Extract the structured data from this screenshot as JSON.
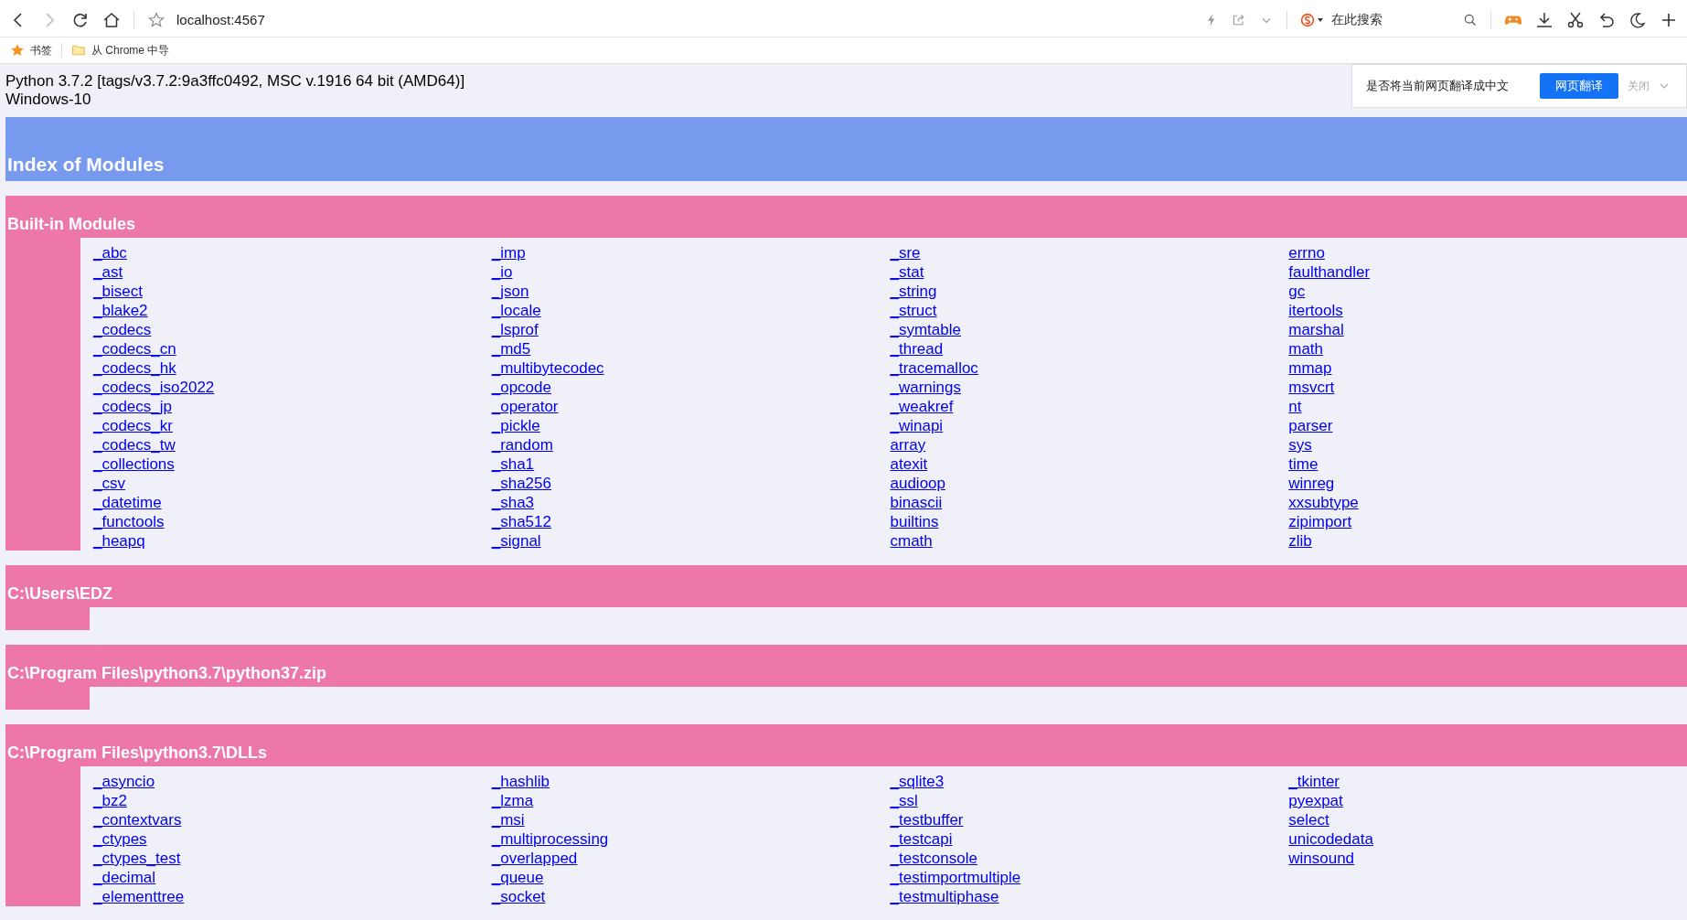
{
  "browser": {
    "address": "localhost:4567",
    "search_placeholder": "在此搜索",
    "bookmarks": [
      {
        "kind": "star",
        "label": "书签"
      },
      {
        "kind": "folder",
        "label": "从 Chrome 中导"
      }
    ]
  },
  "translate_bar": {
    "prompt": "是否将当前网页翻译成中文",
    "translate_button": "网页翻译",
    "close_button": "关闭"
  },
  "page": {
    "sys_info": [
      "Python 3.7.2 [tags/v3.7.2:9a3ffc0492, MSC v.1916 64 bit (AMD64)]",
      "Windows-10"
    ],
    "title": "Index of Modules",
    "sections": [
      {
        "heading": "Built-in Modules",
        "columns": [
          [
            "_abc",
            "_ast",
            "_bisect",
            "_blake2",
            "_codecs",
            "_codecs_cn",
            "_codecs_hk",
            "_codecs_iso2022",
            "_codecs_jp",
            "_codecs_kr",
            "_codecs_tw",
            "_collections",
            "_csv",
            "_datetime",
            "_functools",
            "_heapq"
          ],
          [
            "_imp",
            "_io",
            "_json",
            "_locale",
            "_lsprof",
            "_md5",
            "_multibytecodec",
            "_opcode",
            "_operator",
            "_pickle",
            "_random",
            "_sha1",
            "_sha256",
            "_sha3",
            "_sha512",
            "_signal"
          ],
          [
            "_sre",
            "_stat",
            "_string",
            "_struct",
            "_symtable",
            "_thread",
            "_tracemalloc",
            "_warnings",
            "_weakref",
            "_winapi",
            "array",
            "atexit",
            "audioop",
            "binascii",
            "builtins",
            "cmath"
          ],
          [
            "errno",
            "faulthandler",
            "gc",
            "itertools",
            "marshal",
            "math",
            "mmap",
            "msvcrt",
            "nt",
            "parser",
            "sys",
            "time",
            "winreg",
            "xxsubtype",
            "zipimport",
            "zlib"
          ]
        ]
      },
      {
        "heading": "C:\\Users\\EDZ"
      },
      {
        "heading": "C:\\Program Files\\python3.7\\python37.zip"
      },
      {
        "heading": "C:\\Program Files\\python3.7\\DLLs",
        "columns": [
          [
            "_asyncio",
            "_bz2",
            "_contextvars",
            "_ctypes",
            "_ctypes_test",
            "_decimal",
            "_elementtree"
          ],
          [
            "_hashlib",
            "_lzma",
            "_msi",
            "_multiprocessing",
            "_overlapped",
            "_queue",
            "_socket"
          ],
          [
            "_sqlite3",
            "_ssl",
            "_testbuffer",
            "_testcapi",
            "_testconsole",
            "_testimportmultiple",
            "_testmultiphase"
          ],
          [
            "_tkinter",
            "pyexpat",
            "select",
            "unicodedata",
            "winsound"
          ]
        ]
      }
    ]
  }
}
